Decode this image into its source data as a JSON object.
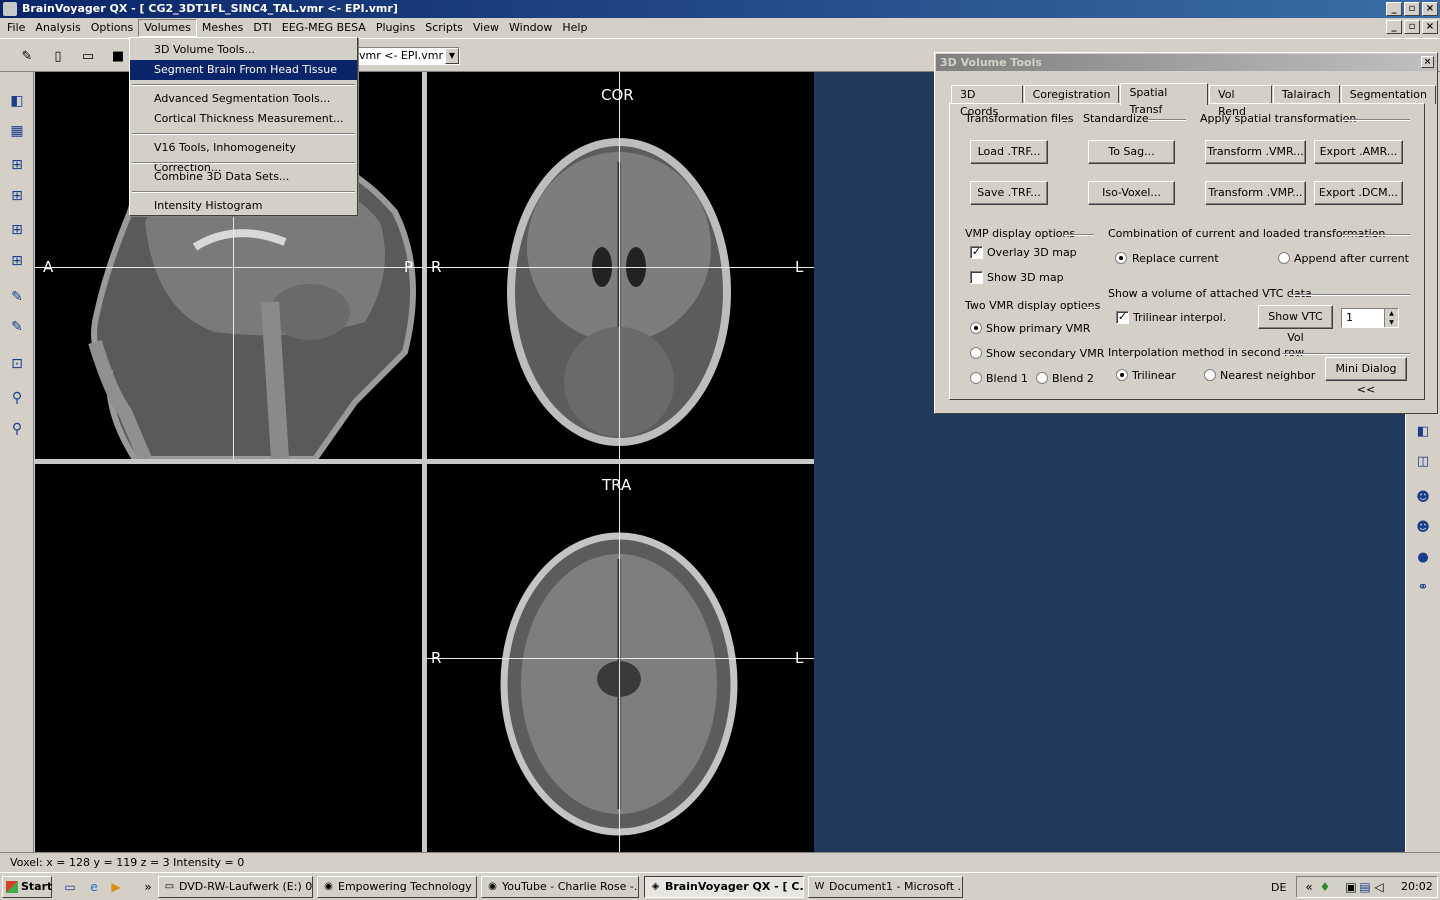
{
  "window": {
    "title": "BrainVoyager QX - [ CG2_3DT1FL_SINC4_TAL.vmr  <-  EPI.vmr]"
  },
  "menubar": {
    "items": [
      "File",
      "Analysis",
      "Options",
      "Volumes",
      "Meshes",
      "DTI",
      "EEG-MEG BESA",
      "Plugins",
      "Scripts",
      "View",
      "Window",
      "Help"
    ]
  },
  "toolbar": {
    "vmr_combo": "vmr  <-  EPI.vmr"
  },
  "volumes_menu": {
    "items": [
      "3D Volume Tools...",
      "Segment Brain From Head Tissue",
      "Advanced Segmentation Tools...",
      "Cortical Thickness Measurement...",
      "V16 Tools, Inhomogeneity Correction...",
      "Combine 3D Data Sets...",
      "Intensity Histogram"
    ],
    "selected": "Segment Brain From Head Tissue"
  },
  "views": {
    "sagittal": {
      "left": "A",
      "right": "P"
    },
    "coronal": {
      "title": "COR",
      "left": "R",
      "right": "L"
    },
    "transversal": {
      "title": "TRA",
      "left": "R",
      "right": "L"
    }
  },
  "dialog": {
    "title": "3D Volume Tools",
    "tabs": [
      "3D Coords",
      "Coregistration",
      "Spatial Transf",
      "Vol Rend",
      "Talairach",
      "Segmentation"
    ],
    "active_tab": "Spatial Transf",
    "groups": {
      "transformation_files": "Transformation files",
      "standardize": "Standardize",
      "apply_spatial": "Apply spatial transformation",
      "vmp_display": "VMP display options",
      "combination": "Combination of current and loaded transformation",
      "two_vmr": "Two VMR display options",
      "vtc": "Show a volume of attached VTC data",
      "interp": "Interpolation method in second row"
    },
    "buttons": {
      "load_trf": "Load .TRF...",
      "save_trf": "Save .TRF...",
      "to_sag": "To Sag...",
      "iso_voxel": "Iso-Voxel...",
      "transform_vmr": "Transform .VMR...",
      "transform_vmp": "Transform .VMP...",
      "export_amr": "Export .AMR...",
      "export_dcm": "Export .DCM...",
      "show_vtc_vol": "Show VTC Vol",
      "mini_dialog": "Mini Dialog <<"
    },
    "checks": {
      "overlay_3d_map": {
        "label": "Overlay 3D map",
        "checked": true
      },
      "show_3d_map": {
        "label": "Show 3D map",
        "checked": false
      },
      "trilinear_interpol": {
        "label": "Trilinear interpol.",
        "checked": true
      }
    },
    "radios": {
      "replace_current": {
        "label": "Replace current",
        "checked": true
      },
      "append_after": {
        "label": "Append after current",
        "checked": false
      },
      "show_primary": {
        "label": "Show primary VMR",
        "checked": true
      },
      "show_secondary": {
        "label": "Show secondary VMR",
        "checked": false
      },
      "blend1": {
        "label": "Blend 1",
        "checked": false
      },
      "blend2": {
        "label": "Blend 2",
        "checked": false
      },
      "trilinear": {
        "label": "Trilinear",
        "checked": true
      },
      "nearest": {
        "label": "Nearest neighbor",
        "checked": false
      }
    },
    "vtc_volume": "1"
  },
  "statusbar": {
    "text": "Voxel:  x = 128 y = 119 z = 3  Intensity = 0"
  },
  "taskbar": {
    "start": "Start",
    "tasks": [
      "DVD-RW-Laufwerk (E:) 0...",
      "Empowering Technology",
      "YouTube - Charlie Rose -...",
      "BrainVoyager QX - [ C...",
      "Document1 - Microsoft ..."
    ],
    "active_task": "BrainVoyager QX - [ C...",
    "language": "DE",
    "time": "20:02"
  }
}
